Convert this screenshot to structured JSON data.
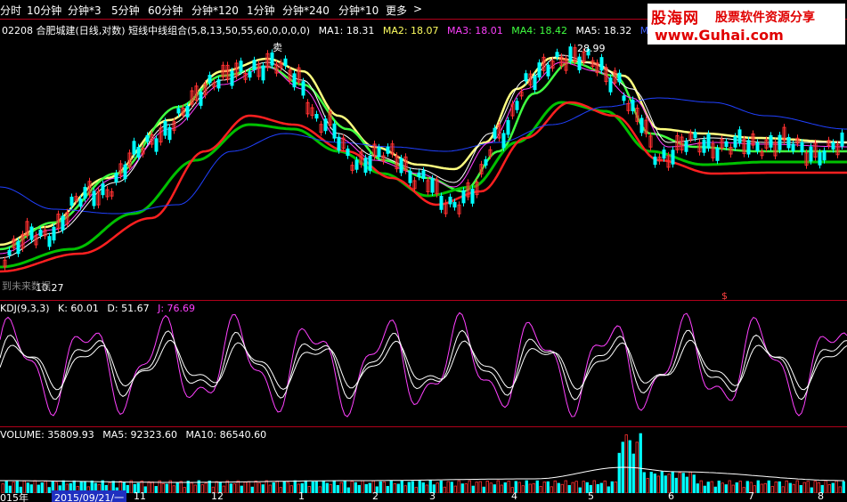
{
  "toolbar": {
    "items": [
      "分时",
      "10分钟",
      "分钟*3",
      "5分钟",
      "60分钟",
      "分钟*120",
      "1分钟",
      "分钟*240",
      "分钟*10",
      "更多"
    ],
    "more_arrow": ">"
  },
  "logo": {
    "brand": "股海网",
    "slogan": "股票软件资源分享",
    "url": "www.Guhai.com"
  },
  "main_legend": {
    "title": "02208 合肥城建(日线,对数) 短线中线组合(5,8,13,50,55,60,0,0,0,0)",
    "ma1": "MA1: 18.31",
    "ma2": "MA2: 18.07",
    "ma3": "MA3: 18.01",
    "ma4": "MA4: 18.42",
    "ma5": "MA5: 18.32",
    "ma6": "MA6: 1"
  },
  "annotations": {
    "sell": "卖",
    "high": "28.99",
    "low": "10.27",
    "future": "到未来数据",
    "dollar": "$"
  },
  "kdj_legend": {
    "title": "KDJ(9,3,3)",
    "k": "K: 60.01",
    "d": "D: 51.67",
    "j": "J: 76.69"
  },
  "vol_legend": {
    "title": "VOLUME: 35809.93",
    "ma5": "MA5: 92323.60",
    "ma10": "MA10: 86540.60"
  },
  "date_axis": {
    "year": "015年",
    "selected_date": "2015/09/21/一",
    "ticks": [
      "11",
      "12",
      "1",
      "2",
      "3",
      "4",
      "5",
      "6",
      "7",
      "8"
    ]
  },
  "colors": {
    "up": "#ff3030",
    "down": "#00ffff",
    "yellow": "#ffff80",
    "green": "#40ff40",
    "darkgreen": "#00c000",
    "red": "#ff2020",
    "blue": "#2040ff",
    "purple": "#ff40ff",
    "white": "#ffffff",
    "grid": "#b0001a"
  }
}
